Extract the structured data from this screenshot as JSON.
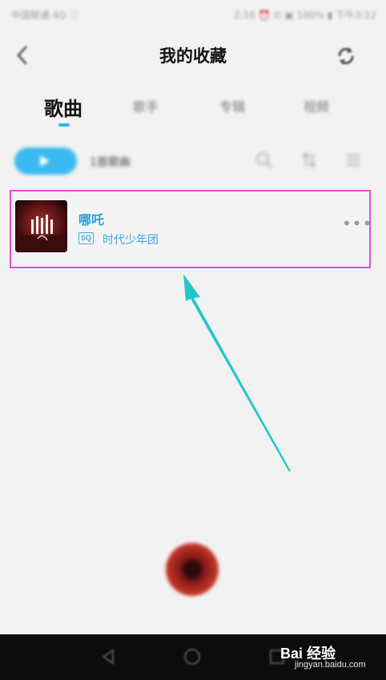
{
  "status_bar": {
    "left": "中国联通 4G ⓘ",
    "right": "2:16 ⏰ ✆ ▣ 100% ▮ 下午3:22"
  },
  "header": {
    "title": "我的收藏",
    "back_icon": "chevron-left-icon",
    "refresh_icon": "refresh-icon"
  },
  "tabs": [
    {
      "label": "歌曲",
      "active": true
    },
    {
      "label": "歌手",
      "active": false
    },
    {
      "label": "专辑",
      "active": false
    },
    {
      "label": "视频",
      "active": false
    }
  ],
  "toolbar": {
    "song_count": "1首歌曲",
    "icons": [
      "search-icon",
      "sort-icon",
      "list-icon"
    ]
  },
  "song": {
    "title": "哪吒",
    "quality": "SQ",
    "artist": "时代少年团",
    "more": "•••"
  },
  "watermark": {
    "main": "Bai 经验",
    "sub": "jingyan.baidu.com"
  },
  "colors": {
    "accent": "#2b9fde",
    "play_button": "#3ab9f0",
    "highlight_border": "#e64ad6",
    "arrow": "#22c6cc"
  }
}
